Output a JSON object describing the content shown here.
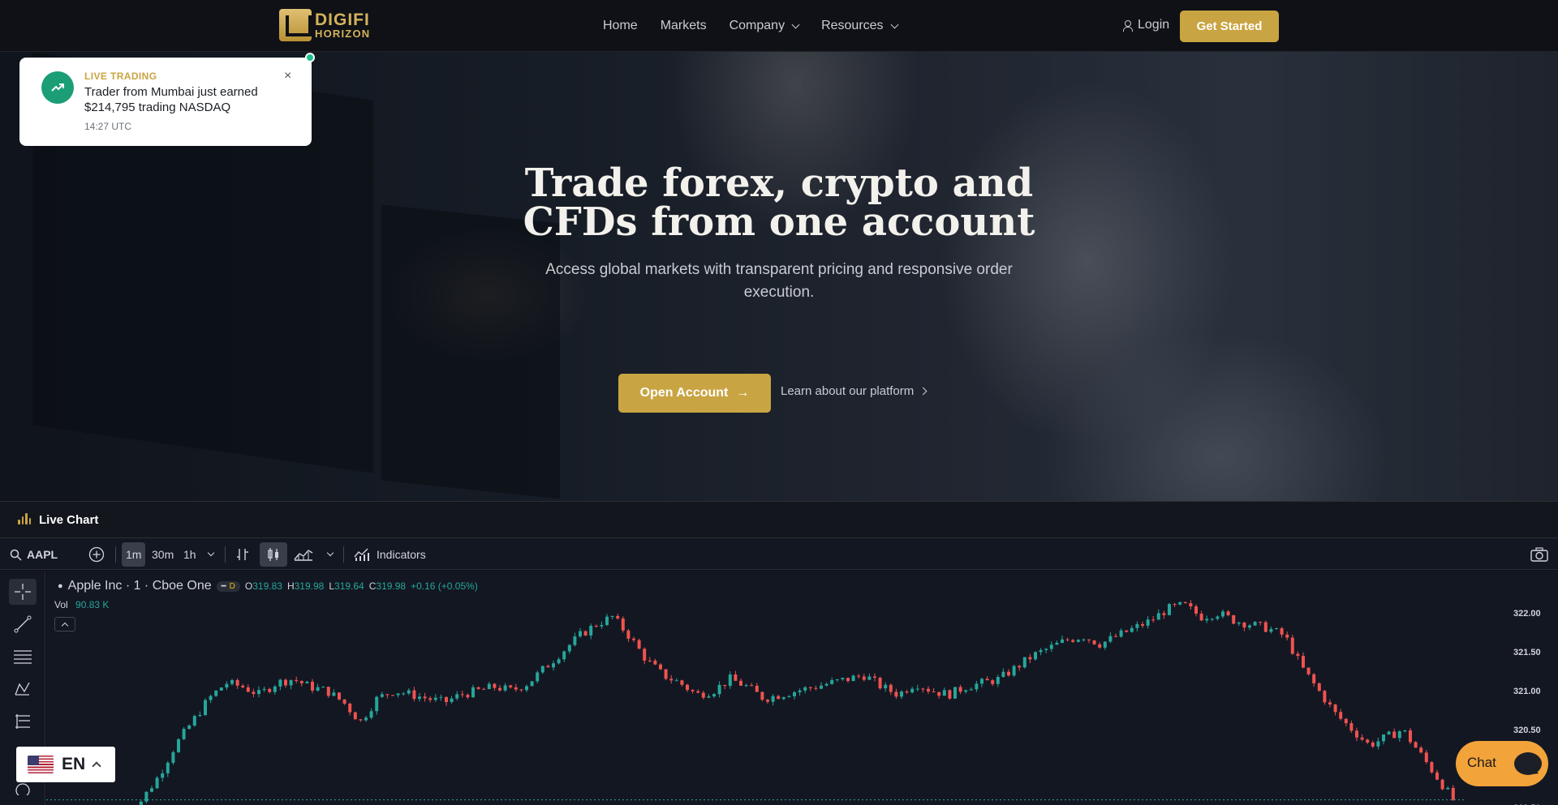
{
  "brand": {
    "line1": "DIGIFI",
    "line2": "HORIZON",
    "accent": "#c9a442"
  },
  "nav": {
    "links": [
      "Home",
      "Markets",
      "Company",
      "Resources"
    ],
    "login": "Login",
    "cta": "Get Started"
  },
  "toast": {
    "label": "LIVE TRADING",
    "message": "Trader from Mumbai just earned $214,795 trading NASDAQ",
    "time": "14:27 UTC",
    "close": "×"
  },
  "hero": {
    "title_line1": "Trade forex, crypto and",
    "title_line2": "CFDs from one account",
    "subtitle": "Access global markets with transparent pricing and responsive order execution.",
    "primary_cta": "Open Account",
    "primary_arrow": "→",
    "secondary_cta": "Learn about our platform",
    "slide_count": 3,
    "active_slide": 1
  },
  "panel": {
    "title": "Live Chart"
  },
  "toolbar": {
    "symbol": "AAPL",
    "timeframes": [
      "1m",
      "30m",
      "1h"
    ],
    "active_timeframe": "1m",
    "indicators": "Indicators"
  },
  "legend": {
    "name": "Apple Inc · 1 · Cboe One",
    "badge": "D",
    "o_label": "O",
    "o": "319.83",
    "h_label": "H",
    "h": "319.98",
    "l_label": "L",
    "l": "319.64",
    "c_label": "C",
    "c": "319.98",
    "change": "+0.16 (+0.05%)",
    "vol_label": "Vol",
    "vol": "90.83 K"
  },
  "chart_data": {
    "type": "candlestick",
    "y_ticks": [
      "322.00",
      "321.50",
      "321.00",
      "320.50",
      "319.50"
    ],
    "y_tick_values": [
      322.0,
      321.5,
      321.0,
      320.5,
      319.5
    ],
    "ylim": [
      319.5,
      322.2
    ],
    "up_color": "#26a69a",
    "down_color": "#ef5350",
    "close_path": [
      319.3,
      319.6,
      319.9,
      320.3,
      320.6,
      320.9,
      321.1,
      321.05,
      320.95,
      321.1,
      321.15,
      321.05,
      321.0,
      320.85,
      320.6,
      320.9,
      321.0,
      320.95,
      320.9,
      320.85,
      320.95,
      321.0,
      321.05,
      321.0,
      321.1,
      321.3,
      321.5,
      321.7,
      321.85,
      321.95,
      321.7,
      321.4,
      321.2,
      321.1,
      320.95,
      321.0,
      321.15,
      321.05,
      320.9,
      320.95,
      321.0,
      321.05,
      321.1,
      321.15,
      321.2,
      321.05,
      320.95,
      321.1,
      321.0,
      320.95,
      321.05,
      321.1,
      321.15,
      321.3,
      321.45,
      321.55,
      321.65,
      321.7,
      321.6,
      321.7,
      321.8,
      321.9,
      322.05,
      322.1,
      321.95,
      322.0,
      321.9,
      321.85,
      321.8,
      321.7,
      321.3,
      321.0,
      320.7,
      320.5,
      320.3,
      320.4,
      320.5,
      320.2,
      319.9,
      319.6
    ]
  },
  "lang": {
    "code": "EN"
  },
  "chat": {
    "label": "Chat"
  }
}
